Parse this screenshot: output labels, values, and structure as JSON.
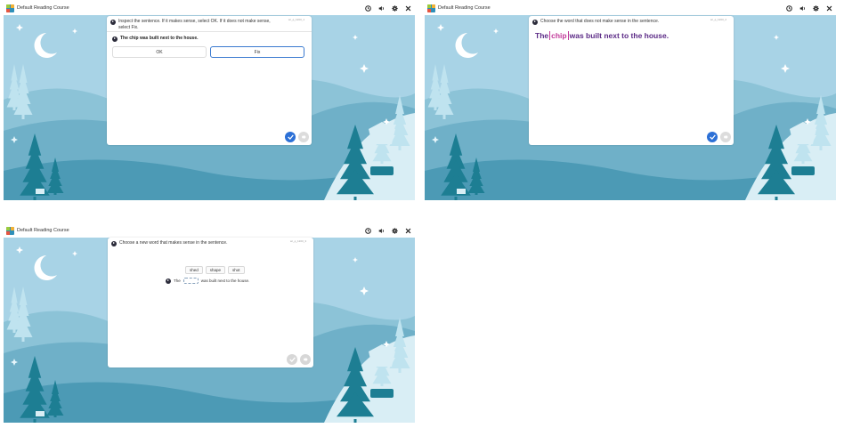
{
  "app_title": "Default Reading Course",
  "controls": [
    {
      "icon": "clock-icon"
    },
    {
      "icon": "speaker-icon"
    },
    {
      "icon": "gear-icon"
    },
    {
      "icon": "close-icon"
    }
  ],
  "colors": {
    "sky": "#a8d3e6",
    "hill_light": "#8cc3d7",
    "hill_mid": "#6fb0c8",
    "hill_dark": "#4c9ab5",
    "tree_dark": "#1d7e93",
    "tree_light": "#bfe3ef",
    "check_blue": "#2c70d6",
    "highlight": "#c23a9a",
    "sentence_purple": "#5b2a86"
  },
  "screen1": {
    "question_id": "wr_q_1203_1",
    "prompt": "Inspect the sentence. If it makes sense, select OK. If it does not make sense, select Fix.",
    "sentence": "The chip was built next to the house.",
    "options": [
      "OK",
      "Fix"
    ],
    "selected_option": "Fix"
  },
  "screen2": {
    "question_id": "wr_q_1203_2",
    "prompt": "Choose the word that does not make sense in the sentence.",
    "sentence_before": "The",
    "sentence_highlight": "chip",
    "sentence_after": "was built next to the house."
  },
  "screen3": {
    "question_id": "wr_q_1203_3",
    "prompt": "Choose a new word that makes sense in the sentence.",
    "word_choices": [
      "shed",
      "shape",
      "shot"
    ],
    "sentence_before": "The",
    "sentence_after": "was built next to the house."
  }
}
